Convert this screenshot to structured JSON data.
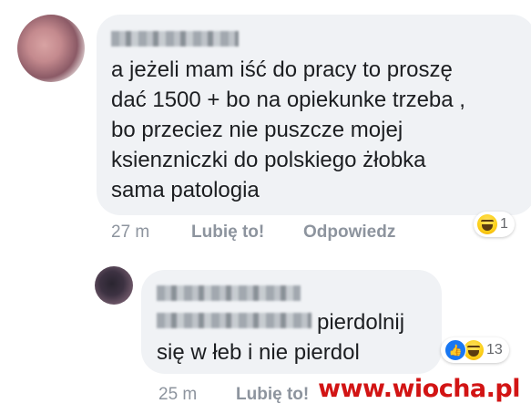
{
  "comment1": {
    "author_name_hidden": true,
    "text": "a jeżeli mam iść do pracy to proszę\ndać 1500 + bo na opiekunke trzeba ,\nbo przeciez nie puszcze mojej\nksienzniczki do polskiego żłobka\nsama patologia",
    "time": "27 m",
    "like_label": "Lubię to!",
    "reply_label": "Odpowiedz",
    "reaction_count": "1",
    "reaction_icons": [
      "haha-emoji"
    ]
  },
  "comment2": {
    "author_name_hidden": true,
    "mention_hidden": true,
    "text_line1": "pierdolnij",
    "text_line2": "się w łeb i nie pierdol",
    "time": "25 m",
    "like_label": "Lubię to!",
    "reaction_count": "13",
    "reaction_icons": [
      "like-icon",
      "haha-emoji"
    ]
  },
  "watermark": "www.wiocha.pl",
  "colors": {
    "bubble": "#f0f2f5",
    "text": "#1c1e21",
    "meta": "#8d949e",
    "like_blue": "#1877f2",
    "watermark": "#d21414"
  }
}
